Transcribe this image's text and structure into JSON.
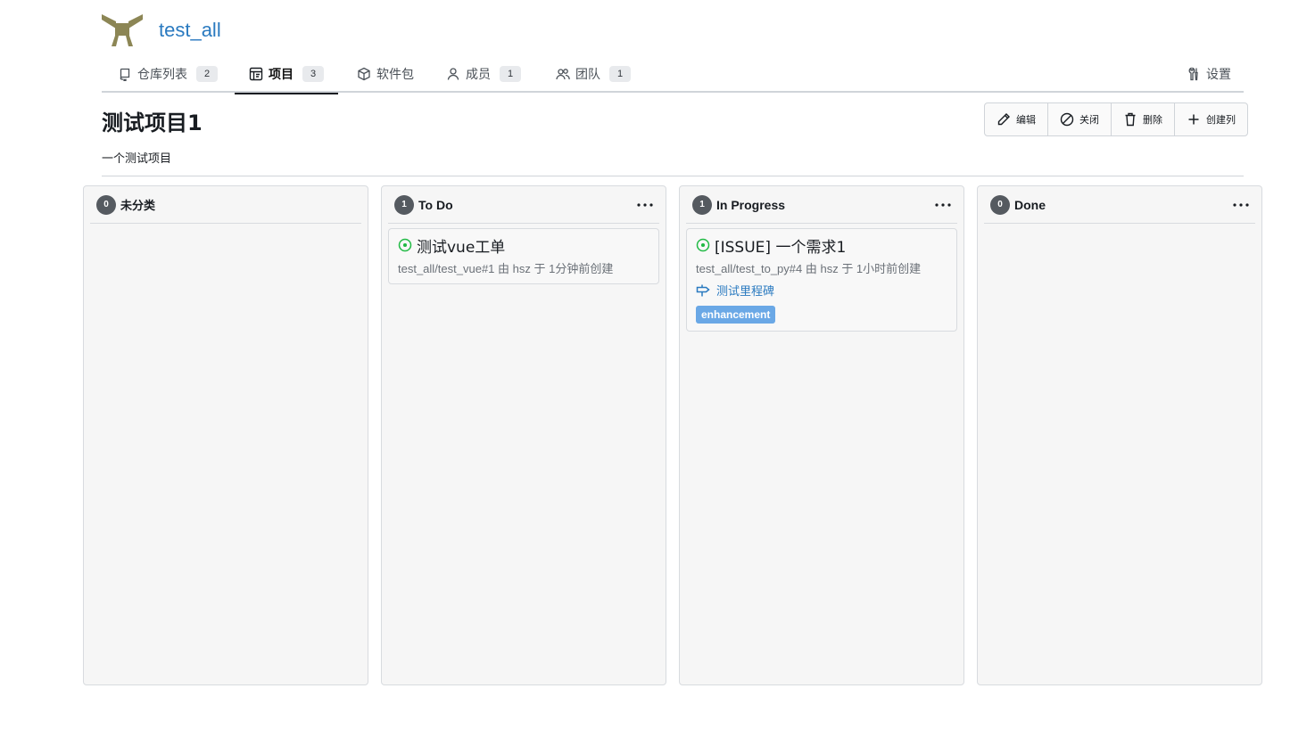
{
  "org": {
    "name": "test_all"
  },
  "tabs": [
    {
      "label": "仓库列表",
      "count": "2",
      "icon": "repo-icon"
    },
    {
      "label": "项目",
      "count": "3",
      "icon": "project-icon"
    },
    {
      "label": "软件包",
      "icon": "package-icon"
    },
    {
      "label": "成员",
      "count": "1",
      "icon": "person-icon"
    },
    {
      "label": "团队",
      "count": "1",
      "icon": "people-icon"
    },
    {
      "label": "设置",
      "icon": "tools-icon"
    }
  ],
  "project": {
    "title": "测试项目1",
    "description": "一个测试项目"
  },
  "actions": {
    "edit": "编辑",
    "close": "关闭",
    "delete": "删除",
    "create_column": "创建列"
  },
  "columns": [
    {
      "title": "未分类",
      "count": "0",
      "cards": []
    },
    {
      "title": "To Do",
      "count": "1",
      "cards": [
        {
          "title": "测试vue工单",
          "meta": "test_all/test_vue#1 由 hsz 于 1分钟前创建",
          "state_icon": "issue-open-icon"
        }
      ]
    },
    {
      "title": "In Progress",
      "count": "1",
      "cards": [
        {
          "title": "[ISSUE] 一个需求1",
          "meta": "test_all/test_to_py#4 由 hsz 于 1小时前创建",
          "milestone": "测试里程碑",
          "label": "enhancement",
          "state_icon": "issue-open-icon"
        }
      ]
    },
    {
      "title": "Done",
      "count": "0",
      "cards": []
    }
  ],
  "colors": {
    "link": "#2a7ac0",
    "issue_open": "#21ba45",
    "label_enhancement": "#6aa8e6",
    "logo": "#8c8655"
  }
}
